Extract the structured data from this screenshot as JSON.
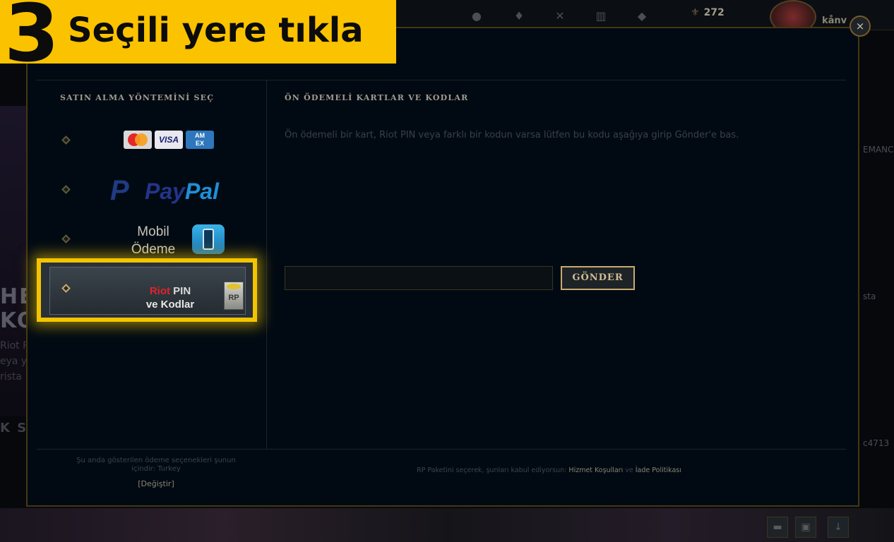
{
  "instruction": {
    "step_number": "3",
    "text": "Seçili yere tıkla"
  },
  "background": {
    "rp_amount": "272",
    "username": "kånv",
    "left_heading_1": "HE",
    "left_heading_2": "KO",
    "left_snippet_1": "Riot P",
    "left_snippet_2": "eya y",
    "left_snippet_3": "rista",
    "left_heading_3": "K SA",
    "right_snippet_1": "EMANC",
    "right_snippet_2": "sta",
    "right_snippet_3": "c4713"
  },
  "modal": {
    "close_symbol": "×",
    "left_title": "SATIN ALMA YÖNTEMİNİ SEÇ",
    "right_title": "ÖN ÖDEMELİ KARTLAR VE KODLAR",
    "methods": {
      "cards": {
        "mastercard": "mastercard-logo",
        "visa": "VISA",
        "amex_line1": "AM",
        "amex_line2": "EX"
      },
      "paypal": {
        "p": "P",
        "pay": "Pay",
        "pal": "Pal"
      },
      "mobile": {
        "line1": "Mobil",
        "line2": "Ödeme"
      },
      "riot": {
        "riot_word": "Riot",
        "pin_word": " PIN",
        "line2": "ve Kodlar",
        "card_label": "RP"
      }
    },
    "description": "Ön ödemeli bir kart, Riot PIN veya farklı bir kodun varsa lütfen bu kodu aşağıya girip Gönder'e bas.",
    "code_input": {
      "value": "",
      "placeholder": ""
    },
    "submit_label": "GÖNDER",
    "footer_left_line1": "Şu anda gösterilen ödeme seçenekleri şunun",
    "footer_left_line2": "içindir:  Turkey",
    "change_link": "[Değiştir]",
    "footer_right_prefix": "RP Paketini seçerek, şunları kabul ediyorsun: ",
    "terms_link": "Hizmet Koşulları",
    "footer_right_mid": " ve ",
    "refund_link": "İade Politikası"
  },
  "colors": {
    "highlight": "#f3c400",
    "banner": "#fbc200",
    "gold_border": "#c8aa6e",
    "modal_bg": "#010a13"
  }
}
